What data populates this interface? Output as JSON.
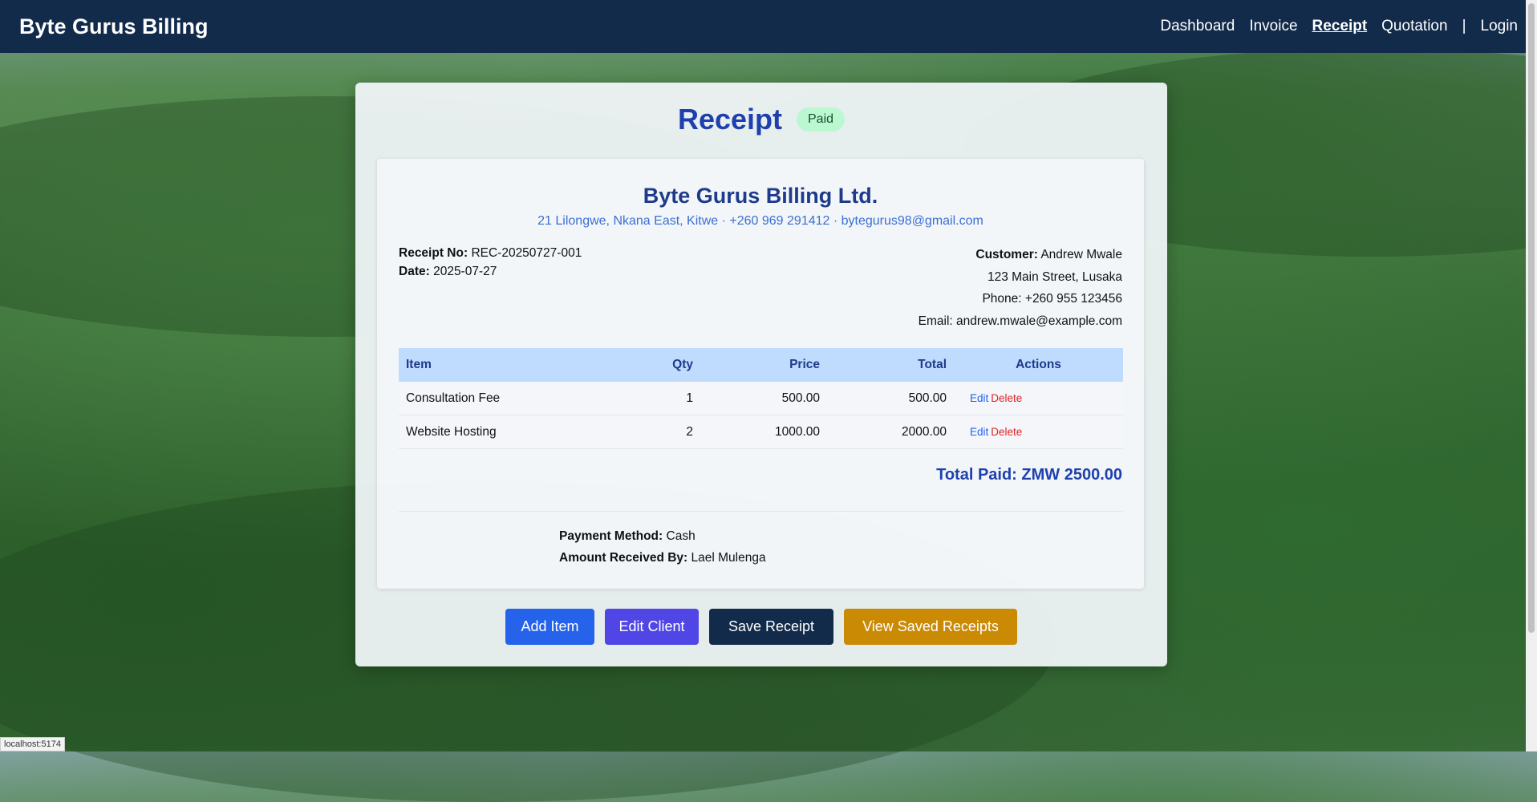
{
  "nav": {
    "brand": "Byte Gurus Billing",
    "links": [
      "Dashboard",
      "Invoice",
      "Receipt",
      "Quotation"
    ],
    "separator": "|",
    "login": "Login"
  },
  "receipt": {
    "title": "Receipt",
    "status": "Paid",
    "company_name": "Byte Gurus Billing Ltd.",
    "company_info": "21 Lilongwe, Nkana East, Kitwe · +260 969 291412 · bytegurus98@gmail.com",
    "receipt_no_label": "Receipt No:",
    "receipt_no": "REC-20250727-001",
    "date_label": "Date:",
    "date": "2025-07-27",
    "customer_label": "Customer:",
    "customer_name": "Andrew Mwale",
    "customer_address": "123 Main Street, Lusaka",
    "customer_phone": "Phone: +260 955 123456",
    "customer_email": "Email: andrew.mwale@example.com",
    "table": {
      "headers": [
        "Item",
        "Qty",
        "Price",
        "Total",
        "Actions"
      ],
      "rows": [
        {
          "item": "Consultation Fee",
          "qty": "1",
          "price": "500.00",
          "total": "500.00"
        },
        {
          "item": "Website Hosting",
          "qty": "2",
          "price": "1000.00",
          "total": "2000.00"
        }
      ],
      "edit_label": "Edit",
      "delete_label": "Delete"
    },
    "total_paid": "Total Paid: ZMW 2500.00",
    "payment_method_label": "Payment Method:",
    "payment_method": "Cash",
    "received_by_label": "Amount Received By:",
    "received_by": "Lael Mulenga"
  },
  "buttons": {
    "add_item": "Add Item",
    "edit_client": "Edit Client",
    "save_receipt": "Save Receipt",
    "view_saved": "View Saved Receipts"
  },
  "status_bar": "localhost:5174"
}
